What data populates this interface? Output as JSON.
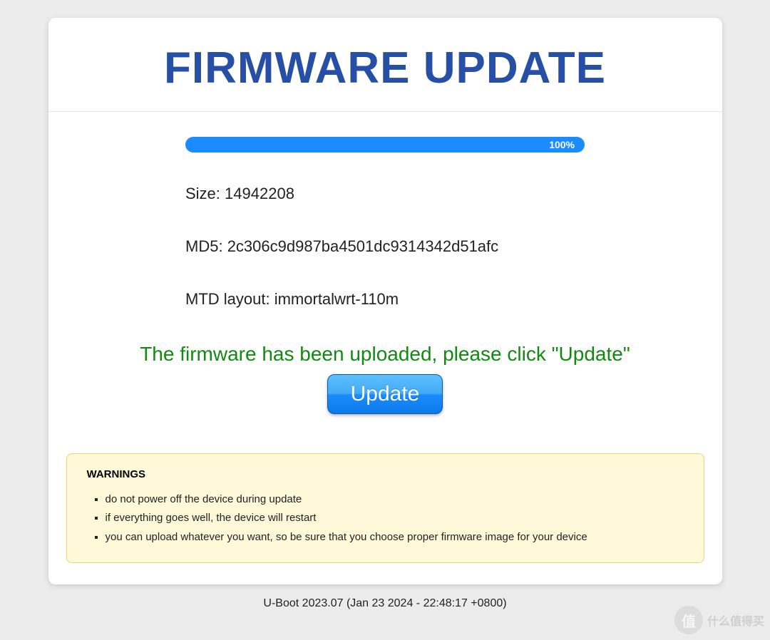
{
  "title": "FIRMWARE UPDATE",
  "progress": {
    "percent_text": "100%"
  },
  "info": {
    "size_label": "Size:",
    "size_value": "14942208",
    "md5_label": "MD5:",
    "md5_value": "2c306c9d987ba4501dc9314342d51afc",
    "mtd_label": "MTD layout:",
    "mtd_value": "immortalwrt-110m"
  },
  "status_message": "The firmware has been uploaded, please click \"Update\"",
  "update_button_label": "Update",
  "warnings": {
    "heading": "WARNINGS",
    "items": [
      "do not power off the device during update",
      "if everything goes well, the device will restart",
      "you can upload whatever you want, so be sure that you choose proper firmware image for your device"
    ]
  },
  "footer": "U-Boot 2023.07 (Jan 23 2024 - 22:48:17 +0800)",
  "watermark": {
    "circle": "值",
    "text": "什么值得买"
  },
  "colors": {
    "title_color": "#284fa6",
    "accent_blue": "#1a8cff",
    "status_green": "#108a10",
    "warning_bg": "#fff9d9",
    "warning_border": "#e6d86f"
  }
}
